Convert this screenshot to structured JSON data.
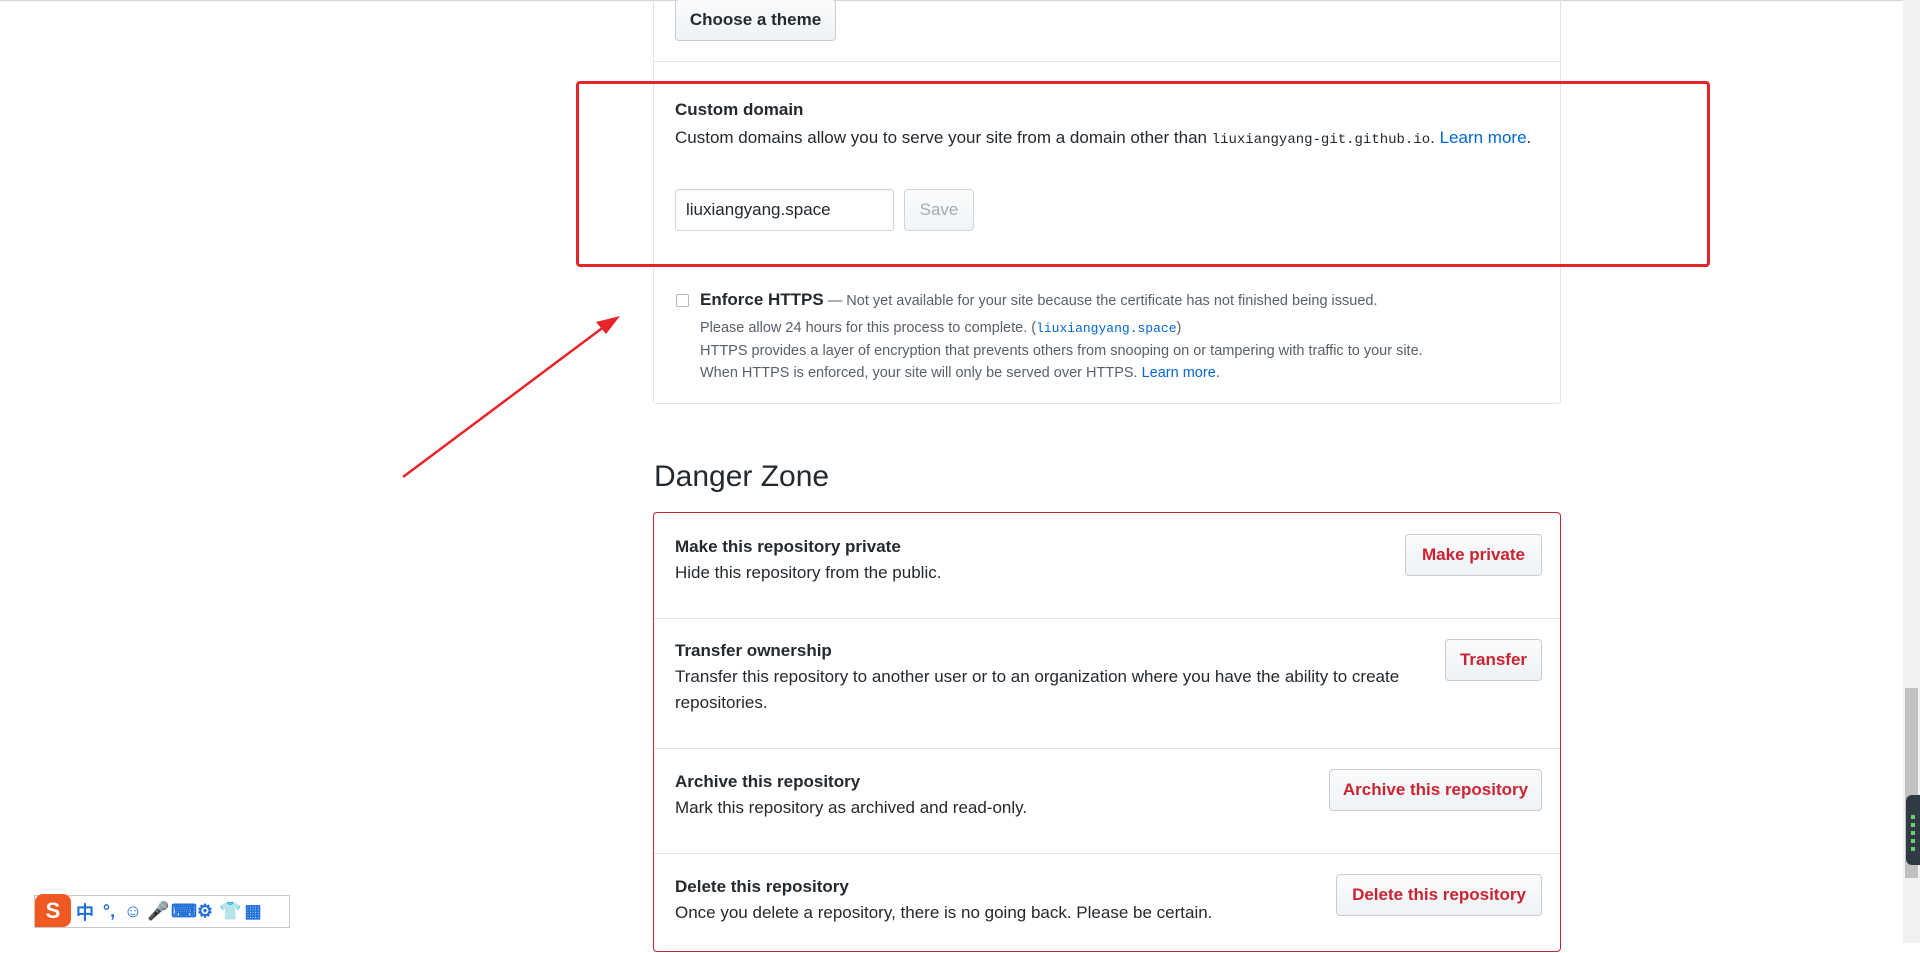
{
  "pages": {
    "choose_theme_label": "Choose a theme",
    "custom_domain": {
      "title": "Custom domain",
      "desc_before": "Custom domains allow you to serve your site from a domain other than ",
      "default_domain": "liuxiangyang-git.github.io",
      "desc_after": ". ",
      "learn_more": "Learn more",
      "desc_end": ".",
      "input_value": "liuxiangyang.space",
      "save_label": "Save"
    },
    "https": {
      "label": "Enforce HTTPS",
      "status": " — Not yet available for your site because the certificate has not finished being issued.",
      "line2_before": "Please allow 24 hours for this process to complete. (",
      "line2_domain": "liuxiangyang.space",
      "line2_after": ")",
      "line3": "HTTPS provides a layer of encryption that prevents others from snooping on or tampering with traffic to your site.",
      "line4": "When HTTPS is enforced, your site will only be served over HTTPS. ",
      "learn_more": "Learn more",
      "line4_end": "."
    }
  },
  "danger_zone": {
    "title": "Danger Zone",
    "items": [
      {
        "name": "Make this repository private",
        "desc": "Hide this repository from the public.",
        "button": "Make private"
      },
      {
        "name": "Transfer ownership",
        "desc": "Transfer this repository to another user or to an organization where you have the ability to create repositories.",
        "button": "Transfer"
      },
      {
        "name": "Archive this repository",
        "desc": "Mark this repository as archived and read-only.",
        "button": "Archive this repository"
      },
      {
        "name": "Delete this repository",
        "desc": "Once you delete a repository, there is no going back. Please be certain.",
        "button": "Delete this repository"
      }
    ]
  },
  "ime": {
    "logo": "S",
    "items": [
      "中",
      "°,",
      "☺",
      "🎤",
      "⌨",
      "⚙",
      "👕",
      "▦"
    ]
  },
  "colors": {
    "link": "#0366d6",
    "danger": "#cb2431",
    "annotation": "#e8232a"
  }
}
